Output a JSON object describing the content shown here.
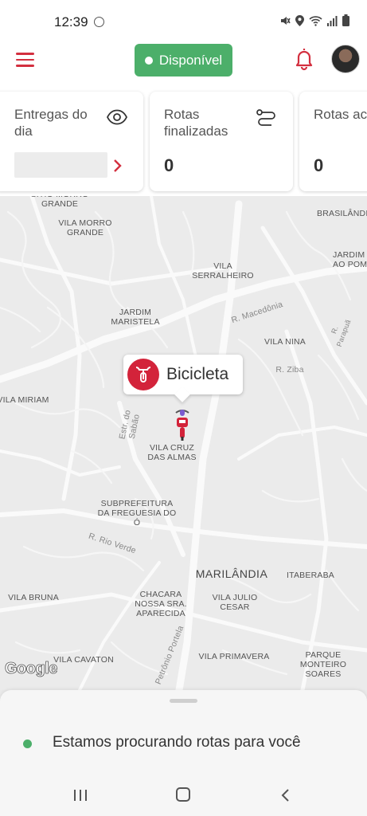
{
  "status_bar": {
    "time": "12:39"
  },
  "header": {
    "availability_label": "Disponível",
    "accent_color": "#d32f3f",
    "status_color": "#4caf6a"
  },
  "cards": [
    {
      "title": "Entregas do dia",
      "value": ""
    },
    {
      "title": "Rotas finalizadas",
      "value": "0"
    },
    {
      "title": "Rotas aceitas",
      "value": "0"
    }
  ],
  "map": {
    "labels": [
      "SÍTIO MORRO GRANDE",
      "VILA MORRO GRANDE",
      "BRASILÂNDIA",
      "JARDIM AO POM",
      "VILA SERRALHEIRO",
      "R. Macedônia",
      "JARDIM MARISTELA",
      "VILA NINA",
      "R. Ziba",
      "R. Parapuã",
      "VILA MIRIAM",
      "Estr. do Sabão",
      "VILA CRUZ DAS ALMAS",
      "SUBPREFEITURA DA FREGUESIA DO Ó",
      "R. Rio Verde",
      "MARILÂNDIA",
      "ITABERABA",
      "VILA BRUNA",
      "CHACARA NOSSA SRA. APARECIDA",
      "VILA JULIO CESAR",
      "VILA CAVATON",
      "Petrônio Portela",
      "VILA PRIMAVERA",
      "PARQUE MONTEIRO SOARES"
    ],
    "provider": "Google",
    "vehicle_label": "Bicicleta"
  },
  "bottom_sheet": {
    "message": "Estamos procurando rotas para você"
  }
}
